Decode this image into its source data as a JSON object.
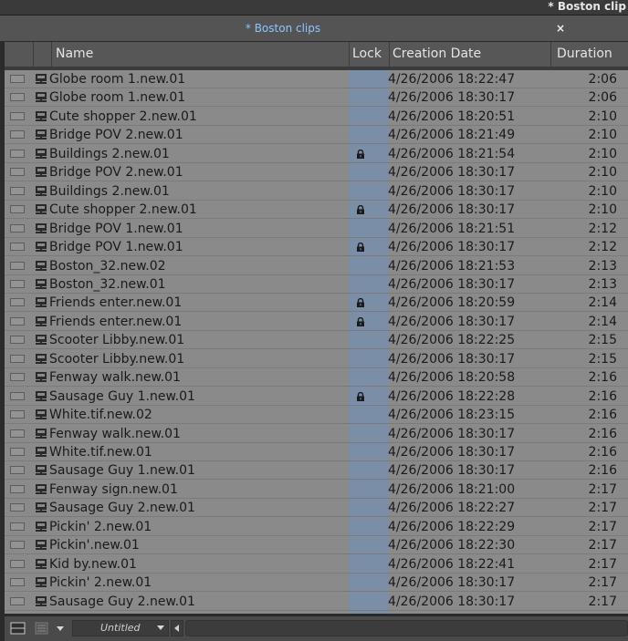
{
  "window": {
    "title": "* Boston clip"
  },
  "tab": {
    "title": "* Boston clips",
    "close_label": "×"
  },
  "columns": {
    "name": "Name",
    "lock": "Lock",
    "date": "Creation Date",
    "duration": "Duration"
  },
  "rows": [
    {
      "name": "Globe room 1.new.01",
      "locked": false,
      "date": "4/26/2006 18:22:47",
      "duration": "2:06"
    },
    {
      "name": "Globe room 1.new.01",
      "locked": false,
      "date": "4/26/2006 18:30:17",
      "duration": "2:06"
    },
    {
      "name": "Cute shopper 2.new.01",
      "locked": false,
      "date": "4/26/2006 18:20:51",
      "duration": "2:10"
    },
    {
      "name": "Bridge POV 2.new.01",
      "locked": false,
      "date": "4/26/2006 18:21:49",
      "duration": "2:10"
    },
    {
      "name": "Buildings 2.new.01",
      "locked": true,
      "date": "4/26/2006 18:21:54",
      "duration": "2:10"
    },
    {
      "name": "Bridge POV 2.new.01",
      "locked": false,
      "date": "4/26/2006 18:30:17",
      "duration": "2:10"
    },
    {
      "name": "Buildings 2.new.01",
      "locked": false,
      "date": "4/26/2006 18:30:17",
      "duration": "2:10"
    },
    {
      "name": "Cute shopper 2.new.01",
      "locked": true,
      "date": "4/26/2006 18:30:17",
      "duration": "2:10"
    },
    {
      "name": "Bridge POV 1.new.01",
      "locked": false,
      "date": "4/26/2006 18:21:51",
      "duration": "2:12"
    },
    {
      "name": "Bridge POV 1.new.01",
      "locked": true,
      "date": "4/26/2006 18:30:17",
      "duration": "2:12"
    },
    {
      "name": "Boston_32.new.02",
      "locked": false,
      "date": "4/26/2006 18:21:53",
      "duration": "2:13"
    },
    {
      "name": "Boston_32.new.01",
      "locked": false,
      "date": "4/26/2006 18:30:17",
      "duration": "2:13"
    },
    {
      "name": "Friends enter.new.01",
      "locked": true,
      "date": "4/26/2006 18:20:59",
      "duration": "2:14"
    },
    {
      "name": "Friends enter.new.01",
      "locked": true,
      "date": "4/26/2006 18:30:17",
      "duration": "2:14"
    },
    {
      "name": "Scooter Libby.new.01",
      "locked": false,
      "date": "4/26/2006 18:22:25",
      "duration": "2:15"
    },
    {
      "name": "Scooter Libby.new.01",
      "locked": false,
      "date": "4/26/2006 18:30:17",
      "duration": "2:15"
    },
    {
      "name": "Fenway walk.new.01",
      "locked": false,
      "date": "4/26/2006 18:20:58",
      "duration": "2:16"
    },
    {
      "name": "Sausage Guy 1.new.01",
      "locked": true,
      "date": "4/26/2006 18:22:28",
      "duration": "2:16"
    },
    {
      "name": "White.tif.new.02",
      "locked": false,
      "date": "4/26/2006 18:23:15",
      "duration": "2:16"
    },
    {
      "name": "Fenway walk.new.01",
      "locked": false,
      "date": "4/26/2006 18:30:17",
      "duration": "2:16"
    },
    {
      "name": "White.tif.new.01",
      "locked": false,
      "date": "4/26/2006 18:30:17",
      "duration": "2:16"
    },
    {
      "name": "Sausage Guy 1.new.01",
      "locked": false,
      "date": "4/26/2006 18:30:17",
      "duration": "2:16"
    },
    {
      "name": "Fenway sign.new.01",
      "locked": false,
      "date": "4/26/2006 18:21:00",
      "duration": "2:17"
    },
    {
      "name": "Sausage Guy 2.new.01",
      "locked": false,
      "date": "4/26/2006 18:22:27",
      "duration": "2:17"
    },
    {
      "name": "Pickin' 2.new.01",
      "locked": false,
      "date": "4/26/2006 18:22:29",
      "duration": "2:17"
    },
    {
      "name": "Pickin'.new.01",
      "locked": false,
      "date": "4/26/2006 18:22:30",
      "duration": "2:17"
    },
    {
      "name": "Kid by.new.01",
      "locked": false,
      "date": "4/26/2006 18:22:41",
      "duration": "2:17"
    },
    {
      "name": "Pickin' 2.new.01",
      "locked": false,
      "date": "4/26/2006 18:30:17",
      "duration": "2:17"
    },
    {
      "name": "Sausage Guy 2.new.01",
      "locked": false,
      "date": "4/26/2006 18:30:17",
      "duration": "2:17"
    }
  ],
  "footer": {
    "view_name": "Untitled"
  },
  "icons": {
    "clip": "clip-icon",
    "lock": "lock-icon"
  },
  "colors": {
    "tab_title": "#8ec5ff",
    "lock_column": "#7b8ea8",
    "row_bg": "#8a8a8a"
  }
}
